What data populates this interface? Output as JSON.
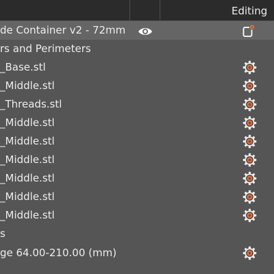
{
  "header": {
    "title": "Editing"
  },
  "object": {
    "label": "de Container v2 - 72mm",
    "visibility_icon": "eye-icon",
    "edit_icon": "edit-settings-icon"
  },
  "group_layers": {
    "label": "rs and Perimeters"
  },
  "parts": [
    {
      "label": "_Base.stl",
      "icon": "gear-icon"
    },
    {
      "label": "_Middle.stl",
      "icon": "gear-icon"
    },
    {
      "label": "_Threads.stl",
      "icon": "gear-icon"
    },
    {
      "label": "_Middle.stl",
      "icon": "gear-icon"
    },
    {
      "label": "_Middle.stl",
      "icon": "gear-icon"
    },
    {
      "label": "_Middle.stl",
      "icon": "gear-icon"
    },
    {
      "label": "_Middle.stl",
      "icon": "gear-icon"
    },
    {
      "label": "_Middle.stl",
      "icon": "gear-icon"
    },
    {
      "label": "_Middle.stl",
      "icon": "gear-icon"
    }
  ],
  "group_ranges": {
    "label": "s"
  },
  "range_item": {
    "label": "ge 64.00-210.00 (mm)",
    "icon": "gear-icon"
  },
  "colors": {
    "background": "#555555",
    "header": "#2b2b2b",
    "selected_row": "#656565",
    "icon_accent": "#e0713a"
  }
}
